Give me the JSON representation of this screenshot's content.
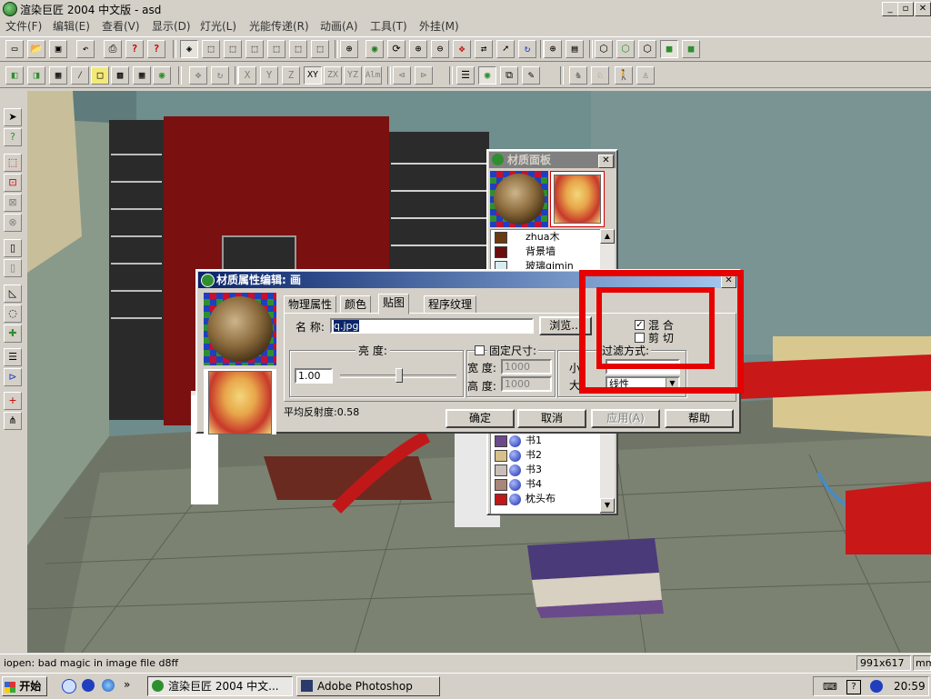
{
  "app": {
    "title": "渲染巨匠 2004 中文版 - asd",
    "window_buttons": [
      "_",
      "▫",
      "✕"
    ]
  },
  "menu": [
    "文件(F)",
    "编辑(E)",
    "查看(V)",
    "显示(D)",
    "灯光(L)",
    "光能传递(R)",
    "动画(A)",
    "工具(T)",
    "外挂(M)"
  ],
  "toolbar2_text": [
    "X",
    "Y",
    "Z",
    "XY",
    "ZX",
    "YZ",
    "Alm"
  ],
  "material_panel": {
    "title": "材质面板",
    "close": "✕",
    "items_top": [
      {
        "label": "zhua木",
        "color": "#6b3a12"
      },
      {
        "label": "背景墙",
        "color": "#6a0e0e"
      },
      {
        "label": "玻璃qimin",
        "color": "#d9ecef"
      }
    ],
    "items_bottom": [
      {
        "label": "书1",
        "color": "#6a4a8a"
      },
      {
        "label": "书2",
        "color": "#d8c08a"
      },
      {
        "label": "书3",
        "color": "#c8c0b8"
      },
      {
        "label": "书4",
        "color": "#a8867a"
      },
      {
        "label": "枕头布",
        "color": "#c01818"
      }
    ],
    "scroll_up": "▲",
    "scroll_down": "▼"
  },
  "editor": {
    "title": "材质属性编辑: 画",
    "close": "✕",
    "tabs": [
      "物理属性",
      "颜色",
      "贴图",
      "程序纹理"
    ],
    "active_tab": "贴图",
    "name_label": "名 称:",
    "name_value": "q.jpg",
    "browse_label": "浏览...",
    "blend_label": "混 合",
    "blend_checked": "✓",
    "clip_label": "剪 切",
    "brightness_title": "亮 度:",
    "brightness_value": "1.00",
    "brightness_level": 0.5,
    "fixed_size_label": "固定尺寸:",
    "width_label": "宽 度:",
    "width_value": "1000",
    "height_label": "高 度:",
    "height_value": "1000",
    "filter_title": "过滤方式:",
    "shrink_label": "小",
    "enlarge_label": "大:",
    "enlarge_value": "线性",
    "avg_reflect": "平均反射度:0.58",
    "buttons": {
      "ok": "确定",
      "cancel": "取消",
      "apply": "应用(A)",
      "help": "帮助"
    }
  },
  "statusbar": {
    "message": "iopen: bad magic in image file d8ff",
    "size": "991x617",
    "unit": "mm"
  },
  "taskbar": {
    "start": "开始",
    "quick_more": "»",
    "tasks": [
      "渲染巨匠 2004 中文...",
      "Adobe Photoshop"
    ],
    "time": "20:59"
  },
  "colors": {
    "titlebar_active": "#0a246a",
    "titlebar_active_end": "#a6caf0",
    "titlebar_inactive": "#808080",
    "highlight": "#e60000",
    "face": "#d4d0c8"
  }
}
